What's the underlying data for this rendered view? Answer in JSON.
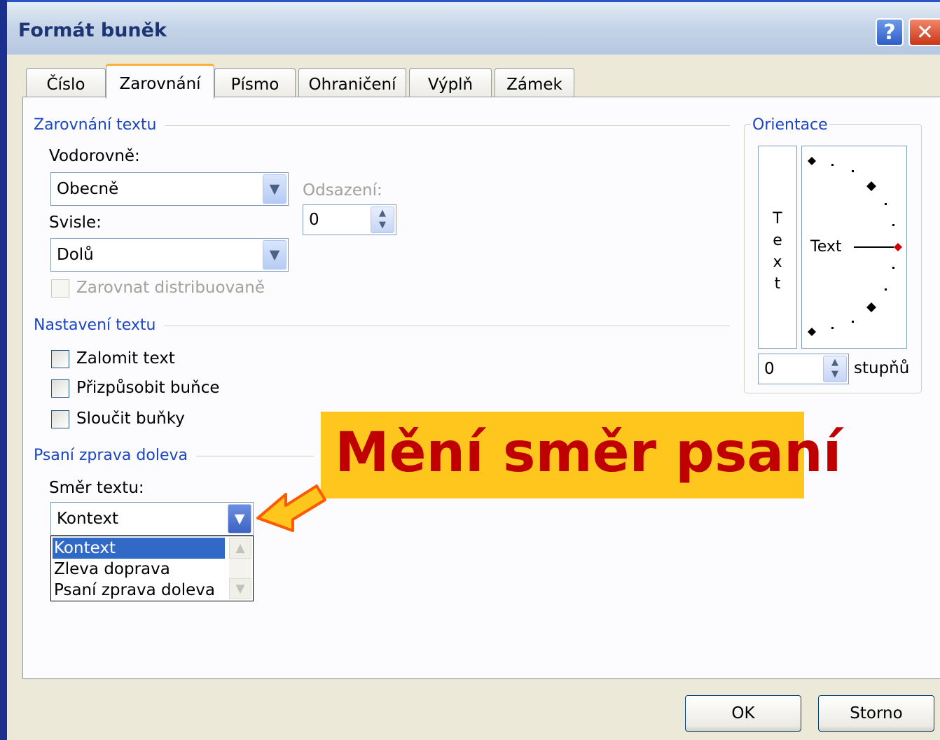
{
  "window": {
    "title": "Formát buněk",
    "help_glyph": "?",
    "close_glyph": "✕"
  },
  "tabs": [
    {
      "label": "Číslo",
      "active": false
    },
    {
      "label": "Zarovnání",
      "active": true
    },
    {
      "label": "Písmo",
      "active": false
    },
    {
      "label": "Ohraničení",
      "active": false
    },
    {
      "label": "Výplň",
      "active": false
    },
    {
      "label": "Zámek",
      "active": false
    }
  ],
  "text_alignment": {
    "group_label": "Zarovnání textu",
    "horizontal_label": "Vodorovně:",
    "horizontal_value": "Obecně",
    "indent_label": "Odsazení:",
    "indent_value": "0",
    "vertical_label": "Svisle:",
    "vertical_value": "Dolů",
    "distributed_label": "Zarovnat distribuovaně",
    "distributed_checked": false
  },
  "text_control": {
    "group_label": "Nastavení textu",
    "wrap_label": "Zalomit text",
    "wrap_checked": false,
    "shrink_label": "Přizpůsobit buňce",
    "shrink_checked": false,
    "merge_label": "Sloučit buňky",
    "merge_checked": false
  },
  "rtl": {
    "group_label": "Psaní zprava doleva",
    "direction_label": "Směr textu:",
    "direction_value": "Kontext",
    "options": [
      "Kontext",
      "Zleva doprava",
      "Psaní zprava doleva"
    ],
    "selected_index": 0
  },
  "orientation": {
    "group_label": "Orientace",
    "vertical_text": [
      "T",
      "e",
      "x",
      "t"
    ],
    "dial_text": "Text",
    "degrees_value": "0",
    "degrees_label": "stupňů"
  },
  "callout": {
    "text": "Mění směr psaní"
  },
  "buttons": {
    "ok": "OK",
    "cancel": "Storno"
  },
  "colors": {
    "accent_group_label": "#1a46c2",
    "callout_bg": "#ffc61e",
    "callout_text": "#c00000",
    "selection": "#3169c6",
    "arrow_fill": "#ffc61e",
    "arrow_stroke": "#ff5a00"
  }
}
